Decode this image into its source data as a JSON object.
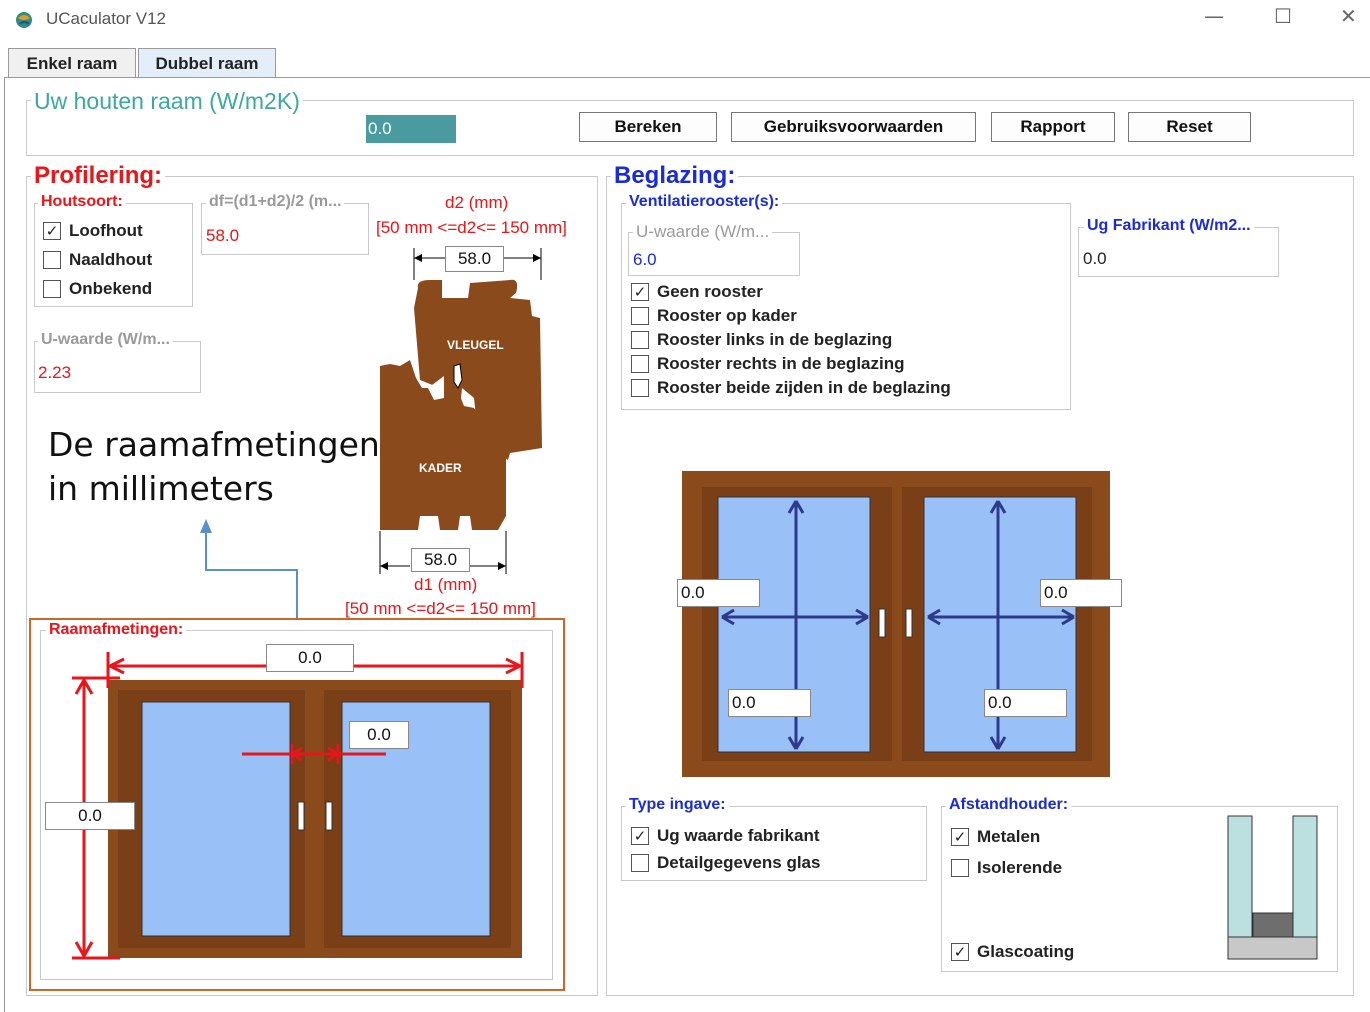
{
  "window": {
    "title": "UCaculator V12",
    "minimize_icon": "minimize-icon",
    "maximize_icon": "maximize-icon",
    "close_icon": "close-icon"
  },
  "tabs": [
    {
      "label": "Enkel raam",
      "active": false
    },
    {
      "label": "Dubbel raam",
      "active": true
    }
  ],
  "result": {
    "title": "Uw houten raam (W/m2K)",
    "value": "0.0"
  },
  "buttons": {
    "calculate": "Bereken",
    "terms": "Gebruiksvoorwaarden",
    "report": "Rapport",
    "reset": "Reset"
  },
  "profiling": {
    "title": "Profilering:",
    "wood_type": {
      "title": "Houtsoort:",
      "options": [
        {
          "label": "Loofhout",
          "checked": true
        },
        {
          "label": "Naaldhout",
          "checked": false
        },
        {
          "label": "Onbekend",
          "checked": false
        }
      ]
    },
    "df": {
      "label": "df=(d1+d2)/2 (m...",
      "value": "58.0"
    },
    "d2": {
      "label": "d2 (mm)",
      "range": "[50 mm <=d2<= 150 mm]",
      "value": "58.0"
    },
    "d1": {
      "label": "d1 (mm)",
      "range": "[50 mm <=d2<= 150 mm]",
      "value": "58.0"
    },
    "u_value": {
      "label": "U-waarde (W/m...",
      "value": "2.23"
    },
    "profile_labels": {
      "sash": "VLEUGEL",
      "frame": "KADER"
    }
  },
  "annotation": {
    "line1": "De raamafmetingen",
    "line2": "in millimeters"
  },
  "dimensions": {
    "title": "Raamafmetingen:",
    "width": "0.0",
    "height": "0.0",
    "middle": "0.0"
  },
  "glazing": {
    "title": "Beglazing:",
    "vent": {
      "title": "Ventilatierooster(s):",
      "u_label": "U-waarde (W/m...",
      "u_value": "6.0",
      "options": [
        {
          "label": "Geen rooster",
          "checked": true
        },
        {
          "label": "Rooster op kader",
          "checked": false
        },
        {
          "label": "Rooster links in de beglazing",
          "checked": false
        },
        {
          "label": "Rooster rechts in de beglazing",
          "checked": false
        },
        {
          "label": "Rooster beide zijden in de beglazing",
          "checked": false
        }
      ]
    },
    "ug": {
      "label": "Ug Fabrikant (W/m2...",
      "value": "0.0"
    },
    "window_inputs": {
      "left_width": "0.0",
      "right_width": "0.0",
      "left_height": "0.0",
      "right_height": "0.0"
    },
    "input_type": {
      "title": "Type ingave:",
      "options": [
        {
          "label": "Ug waarde fabrikant",
          "checked": true
        },
        {
          "label": "Detailgegevens glas",
          "checked": false
        }
      ]
    },
    "spacer": {
      "title": "Afstandhouder:",
      "options": [
        {
          "label": "Metalen",
          "checked": true
        },
        {
          "label": "Isolerende",
          "checked": false
        }
      ],
      "coating": {
        "label": "Glascoating",
        "checked": true
      }
    }
  },
  "colors": {
    "wood": "#8b4a1c",
    "glass": "#99c1f7",
    "red": "#e8161b",
    "blue": "#1a2bd8",
    "teal": "#3aa9a0",
    "arrow": "#2d3a8c"
  }
}
